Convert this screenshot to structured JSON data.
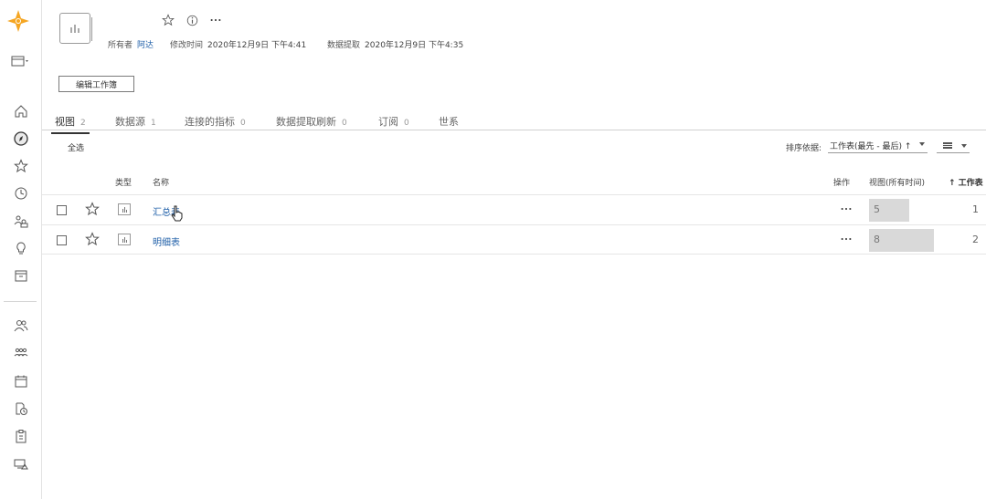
{
  "header": {
    "owner_label": "所有者",
    "owner_name": "阿达",
    "modified_label": "修改时间",
    "modified_value": "2020年12月9日 下午4:41",
    "extract_label": "数据提取",
    "extract_value": "2020年12月9日 下午4:35",
    "icons": [
      "star-icon",
      "info-icon",
      "more-icon"
    ]
  },
  "edit_button_label": "编辑工作簿",
  "tabs": [
    {
      "label": "视图",
      "count": "2"
    },
    {
      "label": "数据源",
      "count": "1"
    },
    {
      "label": "连接的指标",
      "count": "0"
    },
    {
      "label": "数据提取刷新",
      "count": "0"
    },
    {
      "label": "订阅",
      "count": "0"
    },
    {
      "label": "世系",
      "count": ""
    }
  ],
  "toolbar": {
    "select_all": "全选",
    "sort_label": "排序依据:",
    "sort_value": "工作表(最先 - 最后) ↑"
  },
  "table": {
    "headers": {
      "type": "类型",
      "name": "名称",
      "action": "操作",
      "views": "视图(所有时间)",
      "sheet": "↑ 工作表"
    },
    "rows": [
      {
        "name": "汇总表",
        "views": "5",
        "sheet": "1"
      },
      {
        "name": "明细表",
        "views": "8",
        "sheet": "2"
      }
    ]
  },
  "colors": {
    "link": "#1f5fa8",
    "bar": "#d9d9d9",
    "logo": "#f5a623"
  }
}
